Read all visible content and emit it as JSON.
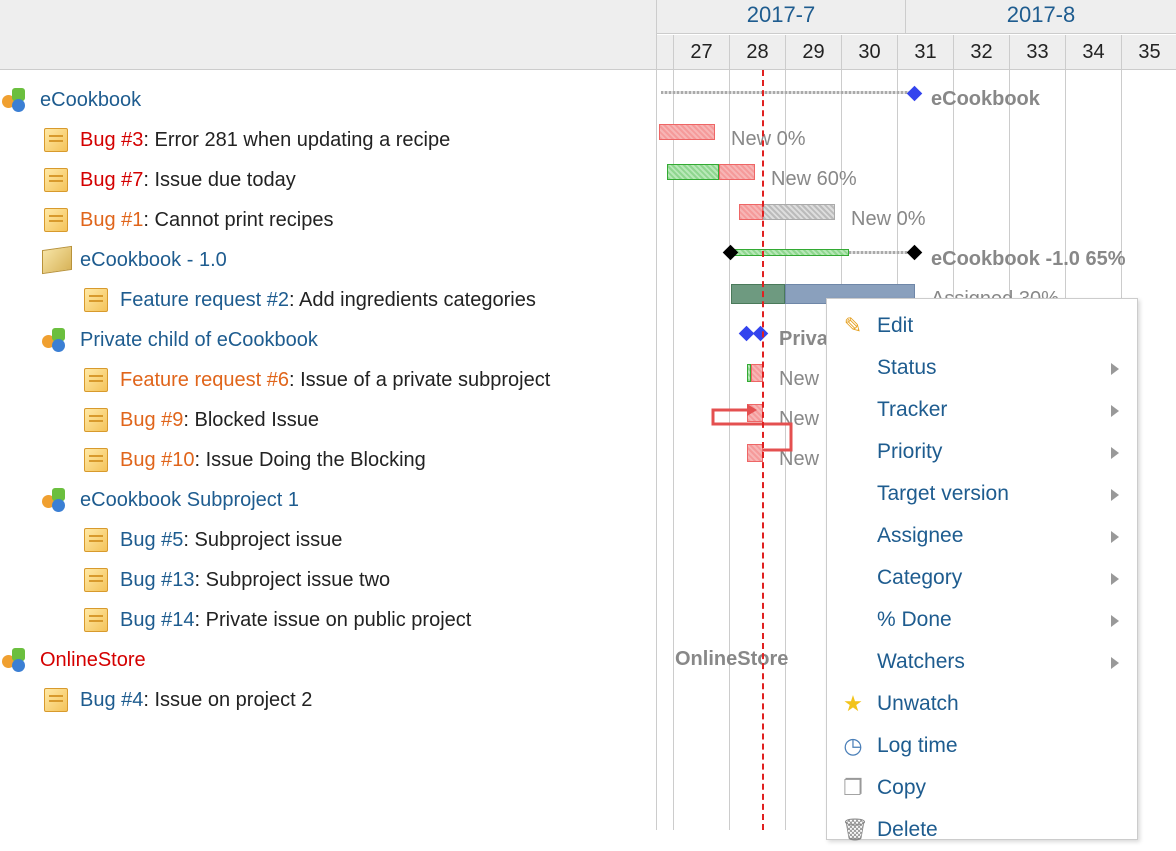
{
  "tree": [
    {
      "type": "project",
      "link": "eCookbook",
      "link_color": "blue",
      "rest": ""
    },
    {
      "type": "issue",
      "link": "Bug #3",
      "link_color": "red",
      "rest": ": Error 281 when updating a recipe"
    },
    {
      "type": "issue",
      "link": "Bug #7",
      "link_color": "red",
      "rest": ": Issue due today"
    },
    {
      "type": "issue",
      "link": "Bug #1",
      "link_color": "orange",
      "rest": ": Cannot print recipes"
    },
    {
      "type": "version",
      "link": "eCookbook - 1.0",
      "link_color": "blue",
      "rest": ""
    },
    {
      "type": "issue",
      "link": "Feature request #2",
      "link_color": "blue",
      "rest": ": Add ingredients categories"
    },
    {
      "type": "project",
      "link": "Private child of eCookbook",
      "link_color": "blue",
      "rest": ""
    },
    {
      "type": "issue",
      "link": "Feature request #6",
      "link_color": "orange",
      "rest": ": Issue of a private subproject"
    },
    {
      "type": "issue",
      "link": "Bug #9",
      "link_color": "orange",
      "rest": ": Blocked Issue"
    },
    {
      "type": "issue",
      "link": "Bug #10",
      "link_color": "orange",
      "rest": ": Issue Doing the Blocking"
    },
    {
      "type": "project",
      "link": "eCookbook Subproject 1",
      "link_color": "blue",
      "rest": ""
    },
    {
      "type": "issue",
      "link": "Bug #5",
      "link_color": "blue",
      "rest": ": Subproject issue"
    },
    {
      "type": "issue",
      "link": "Bug #13",
      "link_color": "blue",
      "rest": ": Subproject issue two"
    },
    {
      "type": "issue",
      "link": "Bug #14",
      "link_color": "blue",
      "rest": ": Private issue on public project"
    },
    {
      "type": "project",
      "link": "OnlineStore",
      "link_color": "red",
      "rest": ""
    },
    {
      "type": "issue",
      "link": "Bug #4",
      "link_color": "blue",
      "rest": ": Issue on project 2"
    }
  ],
  "gantt": {
    "months": [
      "2017-7",
      "2017-8"
    ],
    "days": [
      "27",
      "28",
      "29",
      "30",
      "31",
      "32",
      "33",
      "34",
      "35"
    ],
    "labels": {
      "ecookbook": "eCookbook",
      "bug3": "New 0%",
      "bug7": "New 60%",
      "bug1": "New 0%",
      "version": "eCookbook -1.0 65%",
      "fr2": "Assigned 30%",
      "private": "Private child of eCookbook",
      "fr6": "New",
      "bug9": "New",
      "bug10": "New",
      "onlinestore": "OnlineStore"
    }
  },
  "context_menu": [
    {
      "label": "Edit",
      "icon": "pencil-icon",
      "submenu": false
    },
    {
      "label": "Status",
      "icon": "",
      "submenu": true
    },
    {
      "label": "Tracker",
      "icon": "",
      "submenu": true
    },
    {
      "label": "Priority",
      "icon": "",
      "submenu": true
    },
    {
      "label": "Target version",
      "icon": "",
      "submenu": true
    },
    {
      "label": "Assignee",
      "icon": "",
      "submenu": true
    },
    {
      "label": "Category",
      "icon": "",
      "submenu": true
    },
    {
      "label": "% Done",
      "icon": "",
      "submenu": true
    },
    {
      "label": "Watchers",
      "icon": "",
      "submenu": true
    },
    {
      "label": "Unwatch",
      "icon": "star-icon",
      "submenu": false
    },
    {
      "label": "Log time",
      "icon": "clock-icon",
      "submenu": false
    },
    {
      "label": "Copy",
      "icon": "copy-icon",
      "submenu": false
    },
    {
      "label": "Delete",
      "icon": "trash-icon",
      "submenu": false
    }
  ],
  "colors": {
    "link": "#1e5c8f",
    "red": "#d40000",
    "orange": "#e0651b",
    "today_line": "#e02020"
  }
}
